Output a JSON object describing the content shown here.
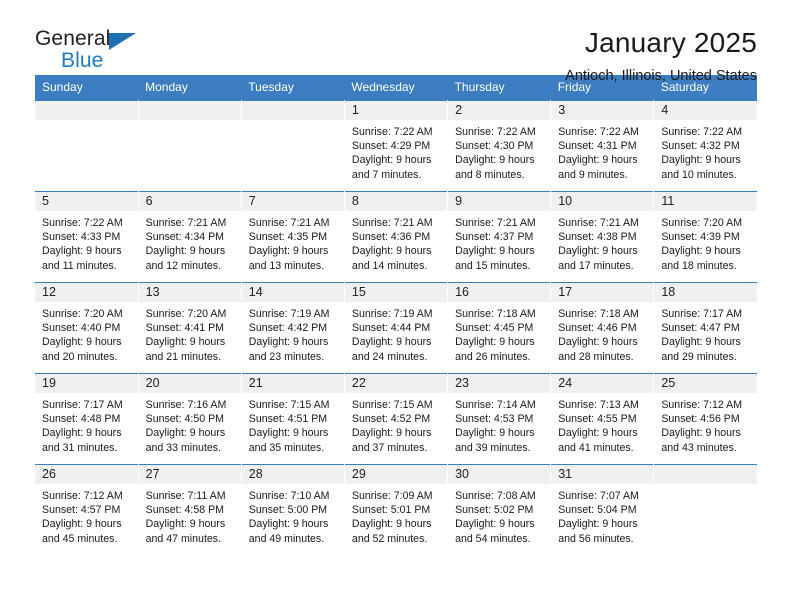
{
  "brand": {
    "name_top": "General",
    "name_bottom": "Blue",
    "triangle_icon": "triangle-icon",
    "color_black": "#231f20",
    "color_blue": "#1f7bc1"
  },
  "header": {
    "title": "January 2025",
    "subtitle": "Antioch, Illinois, United States"
  },
  "theme": {
    "header_bg": "#3b7dc0",
    "header_text": "#ffffff",
    "daynum_bg": "#f0f0f0",
    "cell_bg": "#ffffff",
    "text": "#1a1a1a"
  },
  "weekdays": [
    "Sunday",
    "Monday",
    "Tuesday",
    "Wednesday",
    "Thursday",
    "Friday",
    "Saturday"
  ],
  "labels": {
    "sunrise": "Sunrise:",
    "sunset": "Sunset:",
    "daylight": "Daylight:"
  },
  "weeks": [
    [
      {
        "day": "",
        "sunrise": "",
        "sunset": "",
        "daylight1": "",
        "daylight2": "",
        "empty": true
      },
      {
        "day": "",
        "sunrise": "",
        "sunset": "",
        "daylight1": "",
        "daylight2": "",
        "empty": true
      },
      {
        "day": "",
        "sunrise": "",
        "sunset": "",
        "daylight1": "",
        "daylight2": "",
        "empty": true
      },
      {
        "day": "1",
        "sunrise": "Sunrise: 7:22 AM",
        "sunset": "Sunset: 4:29 PM",
        "daylight1": "Daylight: 9 hours",
        "daylight2": "and 7 minutes.",
        "empty": false
      },
      {
        "day": "2",
        "sunrise": "Sunrise: 7:22 AM",
        "sunset": "Sunset: 4:30 PM",
        "daylight1": "Daylight: 9 hours",
        "daylight2": "and 8 minutes.",
        "empty": false
      },
      {
        "day": "3",
        "sunrise": "Sunrise: 7:22 AM",
        "sunset": "Sunset: 4:31 PM",
        "daylight1": "Daylight: 9 hours",
        "daylight2": "and 9 minutes.",
        "empty": false
      },
      {
        "day": "4",
        "sunrise": "Sunrise: 7:22 AM",
        "sunset": "Sunset: 4:32 PM",
        "daylight1": "Daylight: 9 hours",
        "daylight2": "and 10 minutes.",
        "empty": false
      }
    ],
    [
      {
        "day": "5",
        "sunrise": "Sunrise: 7:22 AM",
        "sunset": "Sunset: 4:33 PM",
        "daylight1": "Daylight: 9 hours",
        "daylight2": "and 11 minutes.",
        "empty": false
      },
      {
        "day": "6",
        "sunrise": "Sunrise: 7:21 AM",
        "sunset": "Sunset: 4:34 PM",
        "daylight1": "Daylight: 9 hours",
        "daylight2": "and 12 minutes.",
        "empty": false
      },
      {
        "day": "7",
        "sunrise": "Sunrise: 7:21 AM",
        "sunset": "Sunset: 4:35 PM",
        "daylight1": "Daylight: 9 hours",
        "daylight2": "and 13 minutes.",
        "empty": false
      },
      {
        "day": "8",
        "sunrise": "Sunrise: 7:21 AM",
        "sunset": "Sunset: 4:36 PM",
        "daylight1": "Daylight: 9 hours",
        "daylight2": "and 14 minutes.",
        "empty": false
      },
      {
        "day": "9",
        "sunrise": "Sunrise: 7:21 AM",
        "sunset": "Sunset: 4:37 PM",
        "daylight1": "Daylight: 9 hours",
        "daylight2": "and 15 minutes.",
        "empty": false
      },
      {
        "day": "10",
        "sunrise": "Sunrise: 7:21 AM",
        "sunset": "Sunset: 4:38 PM",
        "daylight1": "Daylight: 9 hours",
        "daylight2": "and 17 minutes.",
        "empty": false
      },
      {
        "day": "11",
        "sunrise": "Sunrise: 7:20 AM",
        "sunset": "Sunset: 4:39 PM",
        "daylight1": "Daylight: 9 hours",
        "daylight2": "and 18 minutes.",
        "empty": false
      }
    ],
    [
      {
        "day": "12",
        "sunrise": "Sunrise: 7:20 AM",
        "sunset": "Sunset: 4:40 PM",
        "daylight1": "Daylight: 9 hours",
        "daylight2": "and 20 minutes.",
        "empty": false
      },
      {
        "day": "13",
        "sunrise": "Sunrise: 7:20 AM",
        "sunset": "Sunset: 4:41 PM",
        "daylight1": "Daylight: 9 hours",
        "daylight2": "and 21 minutes.",
        "empty": false
      },
      {
        "day": "14",
        "sunrise": "Sunrise: 7:19 AM",
        "sunset": "Sunset: 4:42 PM",
        "daylight1": "Daylight: 9 hours",
        "daylight2": "and 23 minutes.",
        "empty": false
      },
      {
        "day": "15",
        "sunrise": "Sunrise: 7:19 AM",
        "sunset": "Sunset: 4:44 PM",
        "daylight1": "Daylight: 9 hours",
        "daylight2": "and 24 minutes.",
        "empty": false
      },
      {
        "day": "16",
        "sunrise": "Sunrise: 7:18 AM",
        "sunset": "Sunset: 4:45 PM",
        "daylight1": "Daylight: 9 hours",
        "daylight2": "and 26 minutes.",
        "empty": false
      },
      {
        "day": "17",
        "sunrise": "Sunrise: 7:18 AM",
        "sunset": "Sunset: 4:46 PM",
        "daylight1": "Daylight: 9 hours",
        "daylight2": "and 28 minutes.",
        "empty": false
      },
      {
        "day": "18",
        "sunrise": "Sunrise: 7:17 AM",
        "sunset": "Sunset: 4:47 PM",
        "daylight1": "Daylight: 9 hours",
        "daylight2": "and 29 minutes.",
        "empty": false
      }
    ],
    [
      {
        "day": "19",
        "sunrise": "Sunrise: 7:17 AM",
        "sunset": "Sunset: 4:48 PM",
        "daylight1": "Daylight: 9 hours",
        "daylight2": "and 31 minutes.",
        "empty": false
      },
      {
        "day": "20",
        "sunrise": "Sunrise: 7:16 AM",
        "sunset": "Sunset: 4:50 PM",
        "daylight1": "Daylight: 9 hours",
        "daylight2": "and 33 minutes.",
        "empty": false
      },
      {
        "day": "21",
        "sunrise": "Sunrise: 7:15 AM",
        "sunset": "Sunset: 4:51 PM",
        "daylight1": "Daylight: 9 hours",
        "daylight2": "and 35 minutes.",
        "empty": false
      },
      {
        "day": "22",
        "sunrise": "Sunrise: 7:15 AM",
        "sunset": "Sunset: 4:52 PM",
        "daylight1": "Daylight: 9 hours",
        "daylight2": "and 37 minutes.",
        "empty": false
      },
      {
        "day": "23",
        "sunrise": "Sunrise: 7:14 AM",
        "sunset": "Sunset: 4:53 PM",
        "daylight1": "Daylight: 9 hours",
        "daylight2": "and 39 minutes.",
        "empty": false
      },
      {
        "day": "24",
        "sunrise": "Sunrise: 7:13 AM",
        "sunset": "Sunset: 4:55 PM",
        "daylight1": "Daylight: 9 hours",
        "daylight2": "and 41 minutes.",
        "empty": false
      },
      {
        "day": "25",
        "sunrise": "Sunrise: 7:12 AM",
        "sunset": "Sunset: 4:56 PM",
        "daylight1": "Daylight: 9 hours",
        "daylight2": "and 43 minutes.",
        "empty": false
      }
    ],
    [
      {
        "day": "26",
        "sunrise": "Sunrise: 7:12 AM",
        "sunset": "Sunset: 4:57 PM",
        "daylight1": "Daylight: 9 hours",
        "daylight2": "and 45 minutes.",
        "empty": false
      },
      {
        "day": "27",
        "sunrise": "Sunrise: 7:11 AM",
        "sunset": "Sunset: 4:58 PM",
        "daylight1": "Daylight: 9 hours",
        "daylight2": "and 47 minutes.",
        "empty": false
      },
      {
        "day": "28",
        "sunrise": "Sunrise: 7:10 AM",
        "sunset": "Sunset: 5:00 PM",
        "daylight1": "Daylight: 9 hours",
        "daylight2": "and 49 minutes.",
        "empty": false
      },
      {
        "day": "29",
        "sunrise": "Sunrise: 7:09 AM",
        "sunset": "Sunset: 5:01 PM",
        "daylight1": "Daylight: 9 hours",
        "daylight2": "and 52 minutes.",
        "empty": false
      },
      {
        "day": "30",
        "sunrise": "Sunrise: 7:08 AM",
        "sunset": "Sunset: 5:02 PM",
        "daylight1": "Daylight: 9 hours",
        "daylight2": "and 54 minutes.",
        "empty": false
      },
      {
        "day": "31",
        "sunrise": "Sunrise: 7:07 AM",
        "sunset": "Sunset: 5:04 PM",
        "daylight1": "Daylight: 9 hours",
        "daylight2": "and 56 minutes.",
        "empty": false
      },
      {
        "day": "",
        "sunrise": "",
        "sunset": "",
        "daylight1": "",
        "daylight2": "",
        "empty": true
      }
    ]
  ]
}
